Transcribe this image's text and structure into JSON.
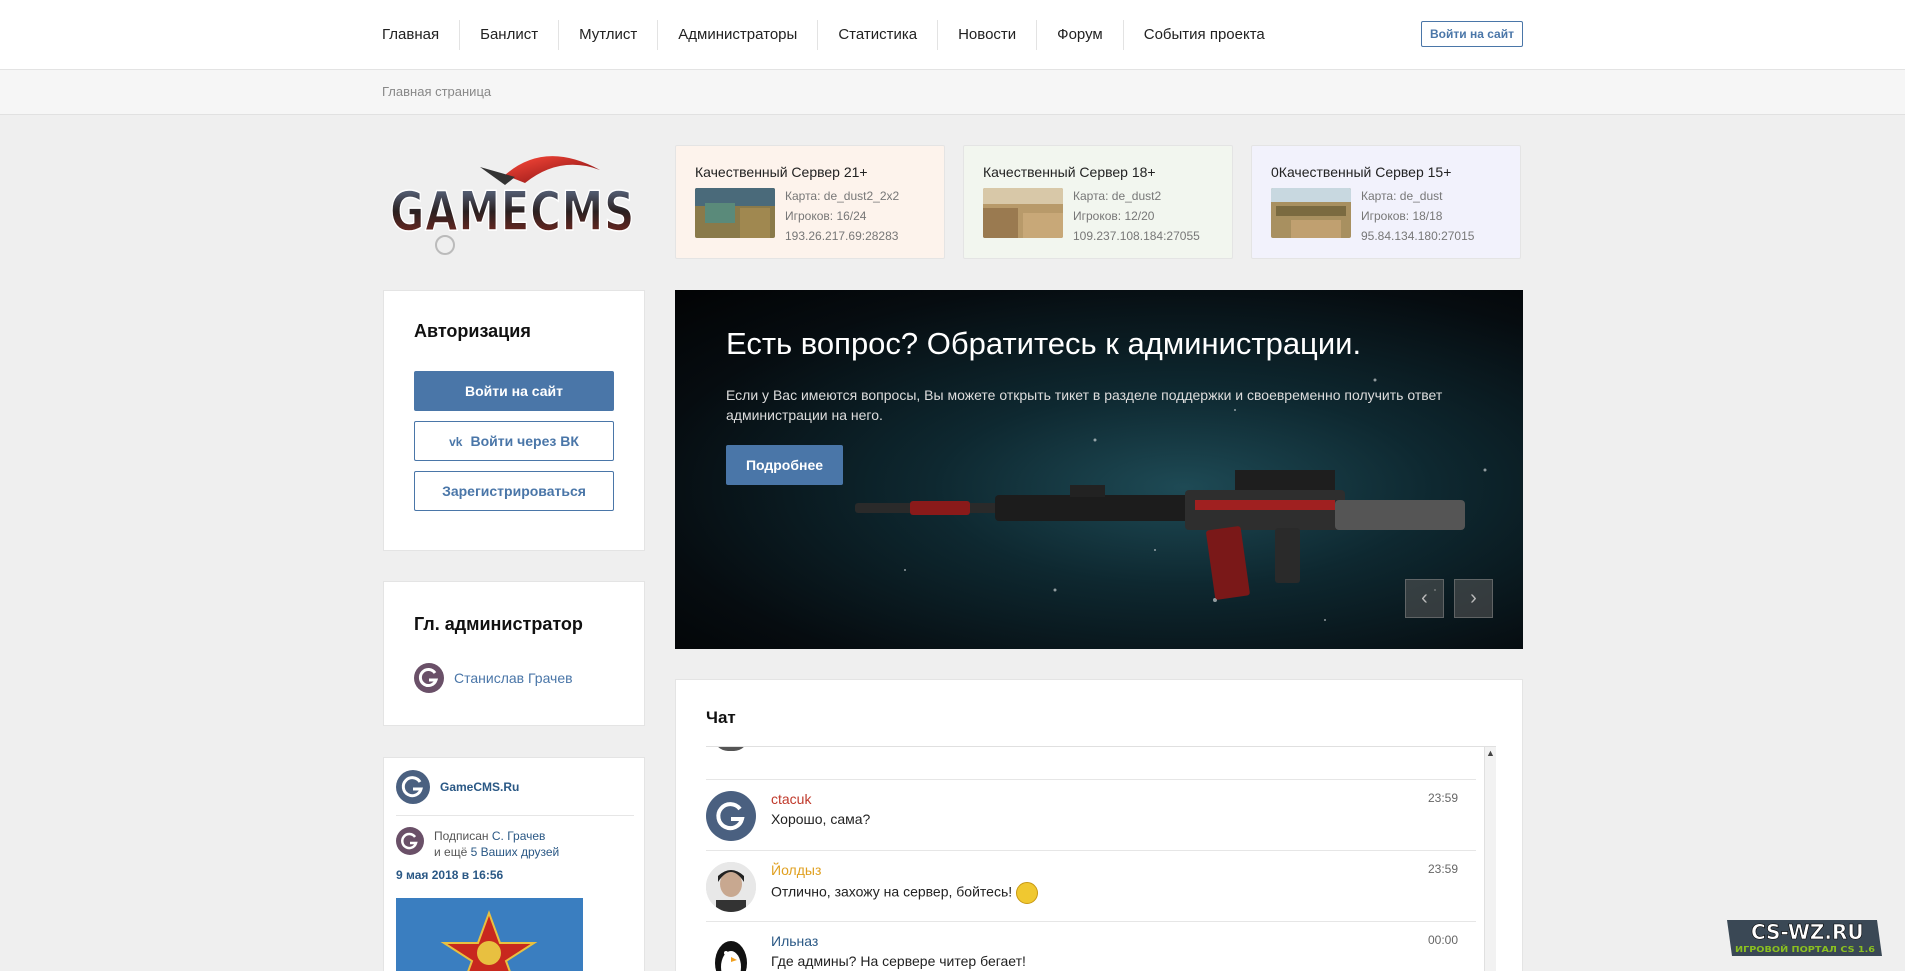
{
  "nav": {
    "items": [
      "Главная",
      "Банлист",
      "Мутлист",
      "Администраторы",
      "Статистика",
      "Новости",
      "Форум",
      "События проекта"
    ],
    "login_button": "Войти на сайт"
  },
  "breadcrumb": "Главная страница",
  "logo": {
    "text": "GAMECMS"
  },
  "servers": [
    {
      "name": "Качественный Сервер 21+",
      "map": "Карта: de_dust2_2x2",
      "players": "Игроков: 16/24",
      "address": "193.26.217.69:28283",
      "bg": "#fdf3ec"
    },
    {
      "name": "Качественный Сервер 18+",
      "map": "Карта: de_dust2",
      "players": "Игроков: 12/20",
      "address": "109.237.108.184:27055",
      "bg": "#f2f6ef"
    },
    {
      "name": "0Качественный Сервер 15+",
      "map": "Карта: de_dust",
      "players": "Игроков: 18/18",
      "address": "95.84.134.180:27015",
      "bg": "#f2f2fc"
    }
  ],
  "auth": {
    "title": "Авторизация",
    "login": "Войти на сайт",
    "vk": "Войти через ВК",
    "register": "Зарегистрироваться"
  },
  "admin": {
    "title": "Гл. администратор",
    "name": "Станислав Грачев"
  },
  "vk_widget": {
    "group": "GameCMS.Ru",
    "subscribed_prefix": "Подписан",
    "subscribed_name": "С. Грачев",
    "and_more_prefix": "и ещё",
    "and_more": "5 Ваших друзей",
    "date": "9 мая 2018 в 16:56"
  },
  "hero": {
    "title": "Есть вопрос? Обратитесь к администрации.",
    "text": "Если у Вас имеются вопросы, Вы можете открыть тикет в разделе поддержки и своевременно получить ответ администрации на него.",
    "button": "Подробнее",
    "prev": "‹",
    "next": "›"
  },
  "chat": {
    "title": "Чат",
    "messages": [
      {
        "nick": "ctacuk",
        "text": "Хорошо, сама?",
        "time": "23:59",
        "color": "#c0392b"
      },
      {
        "nick": "Йолдыз",
        "text": "Отлично, захожу на сервер, бойтесь!",
        "time": "23:59",
        "color": "#e0a020"
      },
      {
        "nick": "Ильназ",
        "text": "Где админы? На сервере читер бегает!",
        "time": "00:00",
        "color": "#2a5885"
      }
    ]
  },
  "watermark": {
    "title": "CS-WZ.RU",
    "subtitle": "ИГРОВОЙ ПОРТАЛ CS 1.6"
  },
  "colors": {
    "accent": "#4a76a8",
    "link": "#2a5885"
  }
}
